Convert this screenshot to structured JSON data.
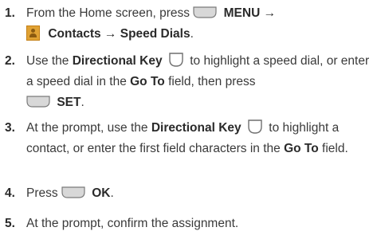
{
  "steps": [
    {
      "num": "1.",
      "p1": "From the Home screen, press",
      "k1": "MENU →",
      "k2": "Contacts → Speed Dials",
      "p2": "."
    },
    {
      "num": "2.",
      "p1": "Use the ",
      "k1": "Directional Key",
      "p2": " to highlight a speed dial, or enter a speed dial in the ",
      "k2": "Go To",
      "p3": " field, then press",
      "k3": "SET",
      "p4": "."
    },
    {
      "num": "3.",
      "p1": "At the prompt, use the ",
      "k1": "Directional Key",
      "p2": " to highlight a contact, or enter the first field characters in the ",
      "k2": "Go To",
      "p3": " field."
    },
    {
      "num": "4.",
      "p1": "Press ",
      "k1": "OK",
      "p2": "."
    },
    {
      "num": "5.",
      "p1": "At the prompt, confirm the assignment."
    }
  ],
  "icons": {
    "soft_key": "soft-key-icon",
    "directional_key": "directional-key-icon",
    "contacts": "contacts-icon"
  }
}
